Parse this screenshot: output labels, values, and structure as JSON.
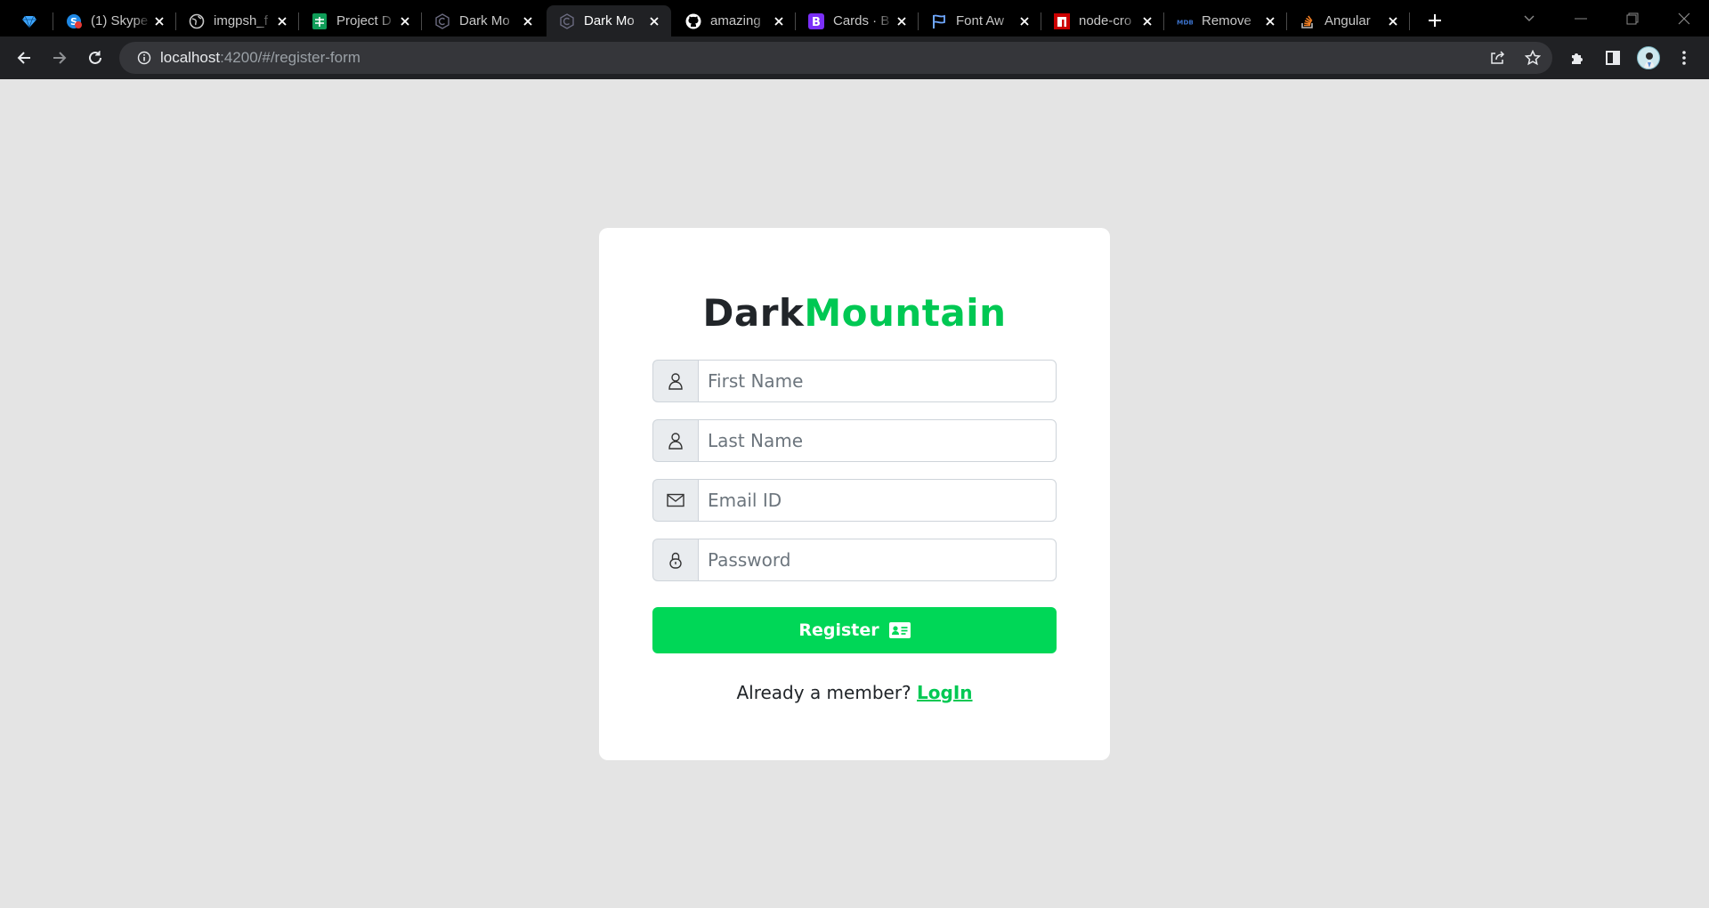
{
  "browser": {
    "tabs": [
      {
        "title": "",
        "icon": "diamond-icon"
      },
      {
        "title": "(1) Skype",
        "icon": "skype-icon"
      },
      {
        "title": "imgpsh_f",
        "icon": "globe-icon"
      },
      {
        "title": "Project D",
        "icon": "sheets-icon"
      },
      {
        "title": "Dark Mo",
        "icon": "circle-c-icon"
      },
      {
        "title": "Dark Mo",
        "icon": "circle-c-icon"
      },
      {
        "title": "amazing",
        "icon": "github-icon"
      },
      {
        "title": "Cards · B",
        "icon": "bootstrap-icon"
      },
      {
        "title": "Font Aw",
        "icon": "flag-icon"
      },
      {
        "title": "node-cro",
        "icon": "npm-icon"
      },
      {
        "title": "Remove",
        "icon": "mdb-icon"
      },
      {
        "title": "Angular",
        "icon": "stackoverflow-icon"
      }
    ],
    "active_tab_index": 5,
    "address": {
      "host": "localhost",
      "path": ":4200/#/register-form"
    }
  },
  "page": {
    "brand": {
      "part1": "Dark",
      "part2": "Mountain"
    },
    "fields": {
      "first_name": {
        "placeholder": "First Name",
        "value": ""
      },
      "last_name": {
        "placeholder": "Last Name",
        "value": ""
      },
      "email": {
        "placeholder": "Email ID",
        "value": ""
      },
      "password": {
        "placeholder": "Password",
        "value": ""
      }
    },
    "register_label": "Register",
    "member_text": "Already a member?",
    "login_link": "LogIn"
  },
  "colors": {
    "accent_green": "#00d757",
    "brand_green": "#00c853",
    "page_background": "#e4e4e4"
  }
}
